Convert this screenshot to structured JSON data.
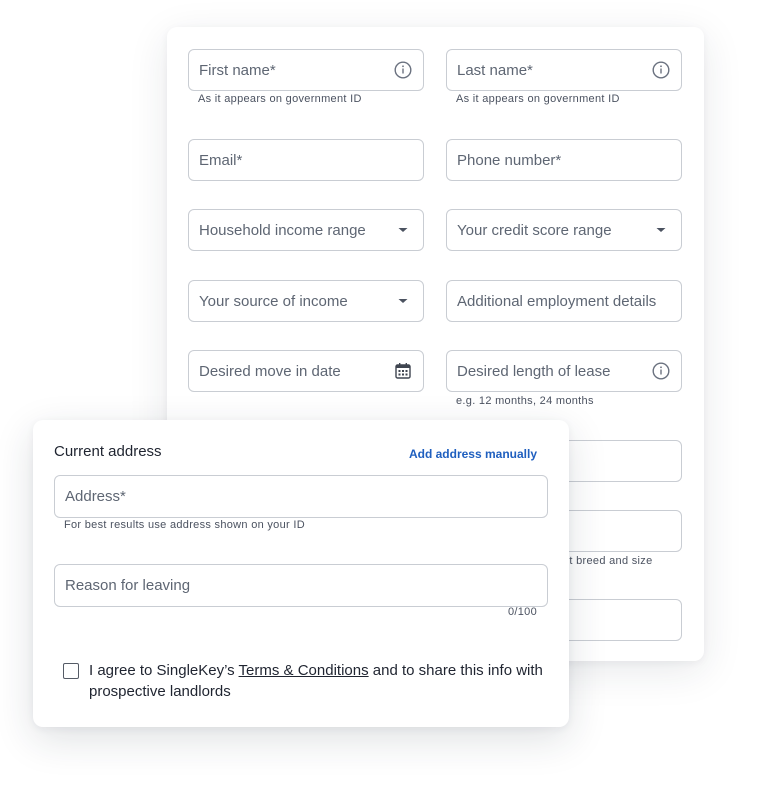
{
  "form": {
    "first_name": {
      "label": "First name*",
      "helper": "As it appears on government ID",
      "icon": "info-icon"
    },
    "last_name": {
      "label": "Last name*",
      "helper": "As it appears on government ID",
      "icon": "info-icon"
    },
    "email": {
      "label": "Email*"
    },
    "phone": {
      "label": "Phone number*"
    },
    "income_range": {
      "label": "Household income range",
      "icon": "caret-down-icon"
    },
    "credit_score": {
      "label": "Your credit score range",
      "icon": "caret-down-icon"
    },
    "income_source": {
      "label": "Your source of income",
      "icon": "caret-down-icon"
    },
    "employment_details": {
      "label": "Additional employment details"
    },
    "move_in_date": {
      "label": "Desired move in date",
      "icon": "calendar-icon"
    },
    "lease_length": {
      "label": "Desired length of lease",
      "helper": "e.g. 12 months, 24 months",
      "icon": "info-icon"
    },
    "pet_helper_partial": "et breed and size"
  },
  "address_card": {
    "title": "Current address",
    "add_manually": "Add address manually",
    "address": {
      "label": "Address*",
      "helper": "For best results use address shown on your ID"
    },
    "reason": {
      "label": "Reason for leaving",
      "counter": "0/100"
    },
    "consent": {
      "checked": false,
      "text_before": "I agree to SingleKey’s ",
      "terms_link": "Terms & Conditions",
      "text_after": " and to share this info with prospective landlords"
    }
  },
  "colors": {
    "border": "#c9cdd3",
    "link": "#1f5fbf",
    "label": "#5e6673"
  }
}
